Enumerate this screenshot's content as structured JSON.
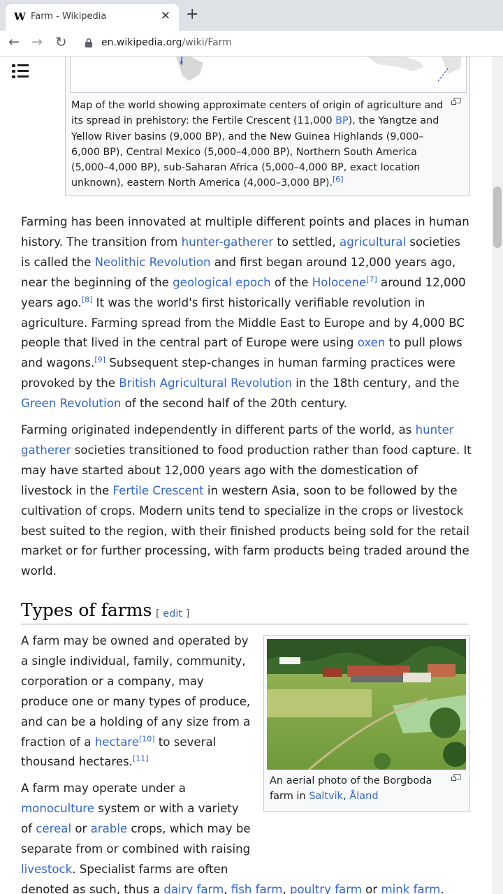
{
  "browser": {
    "tab_title": "Farm - Wikipedia",
    "favicon": "W",
    "url_host": "en.wikipedia.org",
    "url_path": "/wiki/Farm"
  },
  "map_figure": {
    "caption_parts": [
      {
        "t": "Map of the world showing approximate centers of origin of agriculture and its spread in prehistory: the Fertile Crescent (11,000 "
      },
      {
        "t": "BP",
        "link": true
      },
      {
        "t": "), the Yangtze and Yellow River basins (9,000 BP), and the New Guinea Highlands (9,000–6,000 BP), Central Mexico (5,000–4,000 BP), Northern South America (5,000–4,000 BP), sub-Saharan Africa (5,000–4,000 BP, exact location unknown), eastern North America (4,000–3,000 BP)."
      },
      {
        "t": "[6]",
        "sup": true
      }
    ]
  },
  "paragraphs": [
    [
      {
        "t": "Farming has been innovated at multiple different points and places in human history. The transition from "
      },
      {
        "t": "hunter-gatherer",
        "link": true
      },
      {
        "t": " to settled, "
      },
      {
        "t": "agricultural",
        "link": true
      },
      {
        "t": " societies is called the "
      },
      {
        "t": "Neolithic Revolution",
        "link": true
      },
      {
        "t": " and first began around 12,000 years ago, near the beginning of the "
      },
      {
        "t": "geological epoch",
        "link": true
      },
      {
        "t": " of the "
      },
      {
        "t": "Holocene",
        "link": true
      },
      {
        "t": "[7]",
        "sup": true
      },
      {
        "t": " around 12,000 years ago."
      },
      {
        "t": "[8]",
        "sup": true
      },
      {
        "t": " It was the world's first historically verifiable revolution in agriculture. Farming spread from the Middle East to Europe and by 4,000 BC people that lived in the central part of Europe were using "
      },
      {
        "t": "oxen",
        "link": true
      },
      {
        "t": " to pull plows and wagons."
      },
      {
        "t": "[9]",
        "sup": true
      },
      {
        "t": " Subsequent step-changes in human farming practices were provoked by the "
      },
      {
        "t": "British Agricultural Revolution",
        "link": true
      },
      {
        "t": " in the 18th century, and the "
      },
      {
        "t": "Green Revolution",
        "link": true
      },
      {
        "t": " of the second half of the 20th century."
      }
    ],
    [
      {
        "t": "Farming originated independently in different parts of the world, as "
      },
      {
        "t": "hunter gatherer",
        "link": true
      },
      {
        "t": " societies transitioned to food production rather than food capture. It may have started about 12,000 years ago with the domestication of livestock in the "
      },
      {
        "t": "Fertile Crescent",
        "link": true
      },
      {
        "t": " in western Asia, soon to be followed by the cultivation of crops. Modern units tend to specialize in the crops or livestock best suited to the region, with their finished products being sold for the retail market or for further processing, with farm products being traded around the world."
      }
    ]
  ],
  "section": {
    "title": "Types of farms",
    "edit_open": "[ ",
    "edit_label": "edit",
    "edit_close": " ]"
  },
  "farm_figure": {
    "caption_parts": [
      {
        "t": "An aerial photo of the Borgboda farm in "
      },
      {
        "t": "Saltvik",
        "link": true
      },
      {
        "t": ", "
      },
      {
        "t": "Åland",
        "link": true
      }
    ]
  },
  "types_paragraphs": [
    [
      {
        "t": "A farm may be owned and operated by a single individual, family, community, corporation or a company, may produce one or many types of produce, and can be a holding of any size from a fraction of a "
      },
      {
        "t": "hectare",
        "link": true
      },
      {
        "t": "[10]",
        "sup": true
      },
      {
        "t": " to several thousand hectares."
      },
      {
        "t": "[11]",
        "sup": true
      }
    ],
    [
      {
        "t": "A farm may operate under a "
      },
      {
        "t": "monoculture",
        "link": true
      },
      {
        "t": " system or with a variety of "
      },
      {
        "t": "cereal",
        "link": true
      },
      {
        "t": " or "
      },
      {
        "t": "arable",
        "link": true
      },
      {
        "t": " crops, which may be separate from or combined with raising "
      },
      {
        "t": "livestock",
        "link": true
      },
      {
        "t": ". Specialist farms are often denoted as such, thus a "
      },
      {
        "t": "dairy farm",
        "link": true
      },
      {
        "t": ", "
      },
      {
        "t": "fish farm",
        "link": true
      },
      {
        "t": ", "
      },
      {
        "t": "poultry farm",
        "link": true
      },
      {
        "t": " or "
      },
      {
        "t": "mink farm",
        "link": true
      },
      {
        "t": "."
      }
    ]
  ]
}
